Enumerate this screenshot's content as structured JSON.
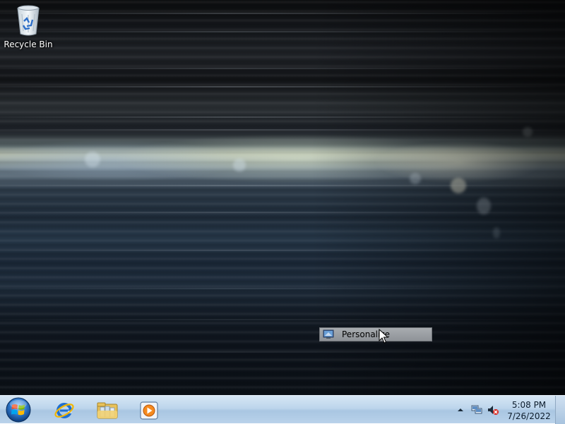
{
  "desktop": {
    "icons": [
      {
        "label": "Recycle Bin",
        "icon": "recycle-bin-icon"
      }
    ]
  },
  "context_menu": {
    "item_label": "Personalize",
    "item_icon": "personalize-icon"
  },
  "taskbar": {
    "start_icon": "windows-start-orb-icon",
    "pinned": [
      {
        "name": "Internet Explorer",
        "icon": "internet-explorer-icon"
      },
      {
        "name": "Windows Explorer",
        "icon": "folder-library-icon"
      },
      {
        "name": "Windows Media Player",
        "icon": "media-player-icon"
      }
    ],
    "tray": {
      "icons": [
        "show-hidden-icons-arrow-icon",
        "network-icon",
        "volume-muted-icon"
      ],
      "time": "5:08 PM",
      "date": "7/26/2022"
    }
  }
}
